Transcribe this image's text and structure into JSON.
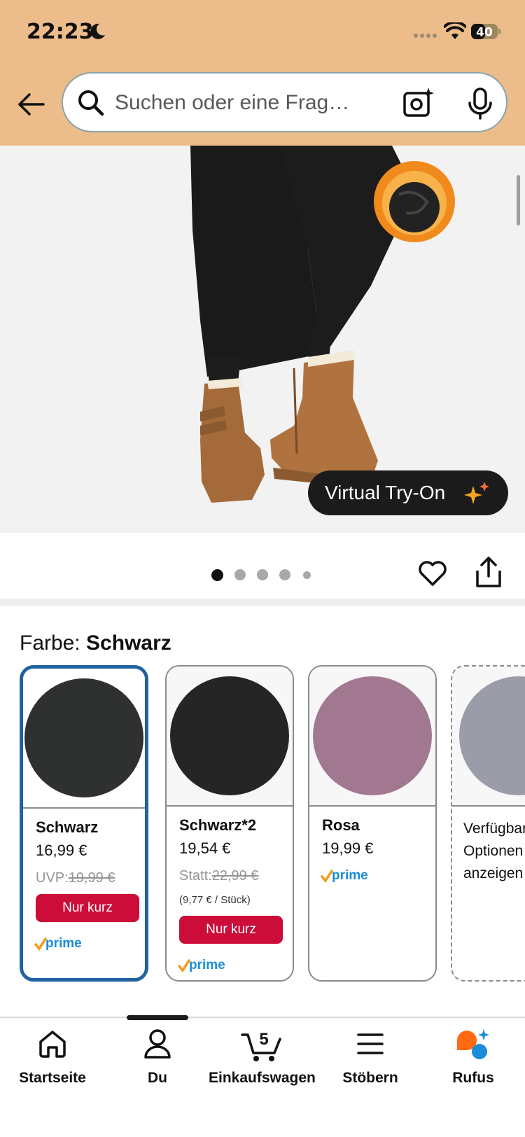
{
  "status_bar": {
    "time": "22:23",
    "battery": "40"
  },
  "search": {
    "placeholder": "Suchen oder eine Frag…"
  },
  "product": {
    "virtual_try_on": "Virtual Try-On",
    "gallery_dots": 5,
    "active_dot": 0
  },
  "variants": {
    "label": "Farbe: ",
    "selected_name": "Schwarz",
    "items": [
      {
        "name": "Schwarz",
        "price": "16,99 €",
        "list_label": "UVP:",
        "list_price": "19,99 €",
        "deal": "Nur kurz",
        "prime": true,
        "color": "#2f3030"
      },
      {
        "name": "Schwarz*2",
        "price": "19,54 €",
        "list_label": "Statt:",
        "list_price": "22,99 €",
        "unit_price": "(9,77 € / Stück)",
        "deal": "Nur kurz",
        "prime": true,
        "color": "#252525"
      },
      {
        "name": "Rosa",
        "price": "19,99 €",
        "prime": true,
        "color": "#a27890"
      },
      {
        "more_line1": "Verfügbare",
        "more_line2": "Optionen",
        "more_line3": "anzeigen",
        "color": "#9a9ca8"
      }
    ]
  },
  "prime_label": "prime",
  "bottom_nav": {
    "items": [
      {
        "label": "Startseite",
        "icon": "home-icon"
      },
      {
        "label": "Du",
        "icon": "user-icon"
      },
      {
        "label": "Einkaufswagen",
        "icon": "cart-icon",
        "badge": "5"
      },
      {
        "label": "Stöbern",
        "icon": "menu-icon"
      },
      {
        "label": "Rufus",
        "icon": "rufus-icon"
      }
    ]
  },
  "colors": {
    "header": "#ecbd8a",
    "selected_border": "#2162a1",
    "deal_red": "#cc0c39",
    "prime_blue": "#1a8cd8",
    "prime_check": "#f39b1b"
  }
}
